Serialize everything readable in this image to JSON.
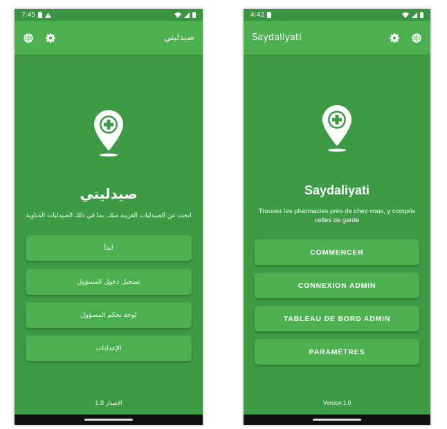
{
  "screens": [
    {
      "status_bar": {
        "time": "7:45"
      },
      "app_bar": {
        "title": "صيدليتي"
      },
      "main": {
        "title": "صيدليتي",
        "subtitle": "ابحث عن الصيدليات القريبة منك، بما في ذلك الصيدليات المناوبة",
        "buttons": [
          "ابدأ",
          "تسجيل دخول المسؤول",
          "لوحة تحكم المسؤول",
          "الإعدادات"
        ],
        "version": "الإصدار 1.0"
      }
    },
    {
      "status_bar": {
        "time": "4:42"
      },
      "app_bar": {
        "title": "Saydaliyati"
      },
      "main": {
        "title": "Saydaliyati",
        "subtitle": "Trouvez les pharmacies près de chez vous, y compris celles de garde",
        "buttons": [
          "COMMENCER",
          "CONNEXION ADMIN",
          "TABLEAU DE BORD ADMIN",
          "PARAMÈTRES"
        ],
        "version": "Version 1.0"
      }
    }
  ],
  "icons": [
    "globe-icon",
    "gear-icon",
    "map-pin-plus-icon",
    "wifi-icon",
    "signal-icon",
    "battery-icon",
    "sim-icon",
    "warning-icon"
  ],
  "colors": {
    "background": "#3d9b45",
    "app_bar": "#4caf50",
    "button": "#4caf50",
    "text": "#ffffff",
    "nav_bar": "#111111"
  }
}
